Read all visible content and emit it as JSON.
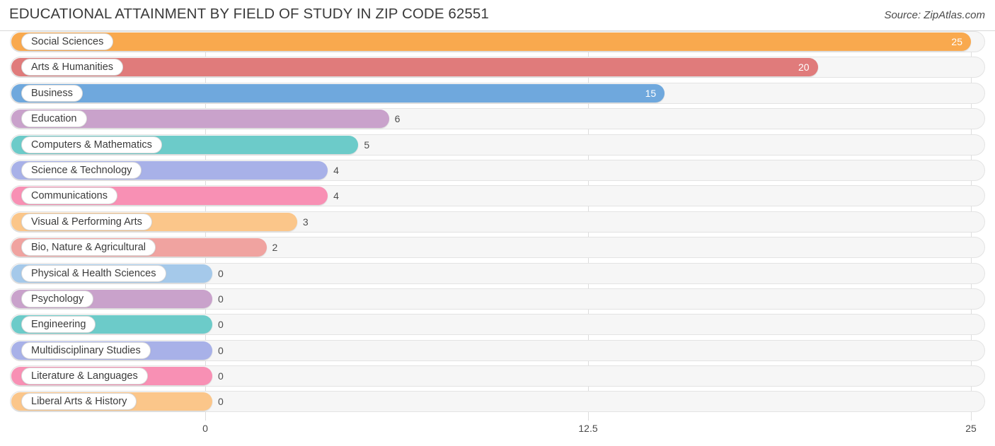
{
  "header": {
    "title": "EDUCATIONAL ATTAINMENT BY FIELD OF STUDY IN ZIP CODE 62551",
    "source": "Source: ZipAtlas.com"
  },
  "chart_data": {
    "type": "bar",
    "orientation": "horizontal",
    "title": "EDUCATIONAL ATTAINMENT BY FIELD OF STUDY IN ZIP CODE 62551",
    "xlabel": "",
    "ylabel": "",
    "xlim": [
      0,
      25
    ],
    "xticks": [
      0,
      12.5,
      25
    ],
    "xtick_labels": [
      "0",
      "12.5",
      "25"
    ],
    "grid": true,
    "legend": false,
    "categories": [
      "Social Sciences",
      "Arts & Humanities",
      "Business",
      "Education",
      "Computers & Mathematics",
      "Science & Technology",
      "Communications",
      "Visual & Performing Arts",
      "Bio, Nature & Agricultural",
      "Physical & Health Sciences",
      "Psychology",
      "Engineering",
      "Multidisciplinary Studies",
      "Literature & Languages",
      "Liberal Arts & History"
    ],
    "values": [
      25,
      20,
      15,
      6,
      5,
      4,
      4,
      3,
      2,
      0,
      0,
      0,
      0,
      0,
      0
    ],
    "value_labels": [
      "25",
      "20",
      "15",
      "6",
      "5",
      "4",
      "4",
      "3",
      "2",
      "0",
      "0",
      "0",
      "0",
      "0",
      "0"
    ],
    "colors": [
      "#f9a košt"
    ]
  },
  "bars": [
    {
      "label": "Social Sciences",
      "value": 25,
      "value_label": "25",
      "color": "#f9a köstd"
    },
    {
      "label": "Arts & Humanities",
      "value": 20,
      "value_label": "20",
      "color": "#e07b7b"
    },
    {
      "label": "Business",
      "value": 15,
      "value_label": "15",
      "color": "#6fa8dd"
    },
    {
      "label": "Education",
      "value": 6,
      "value_label": "6",
      "color": "#c9a2cb"
    },
    {
      "label": "Computers & Mathematics",
      "value": 5,
      "value_label": "5",
      "color": "#6ccbc9"
    },
    {
      "label": "Science & Technology",
      "value": 4,
      "value_label": "4",
      "color": "#a8b1e8"
    },
    {
      "label": "Communications",
      "value": 4,
      "value_label": "4",
      "color": "#f890b4"
    },
    {
      "label": "Visual & Performing Arts",
      "value": 3,
      "value_label": "3",
      "color": "#fbc68a"
    },
    {
      "label": "Bio, Nature & Agricultural",
      "value": 2,
      "value_label": "2",
      "color": "#f0a3a0"
    },
    {
      "label": "Physical & Health Sciences",
      "value": 0,
      "value_label": "0",
      "color": "#a5c9ea"
    },
    {
      "label": "Psychology",
      "value": 0,
      "value_label": "0",
      "color": "#c9a2cb"
    },
    {
      "label": "Engineering",
      "value": 0,
      "value_label": "0",
      "color": "#6ccbc9"
    },
    {
      "label": "Multidisciplinary Studies",
      "value": 0,
      "value_label": "0",
      "color": "#a8b1e8"
    },
    {
      "label": "Literature & Languages",
      "value": 0,
      "value_label": "0",
      "color": "#f890b4"
    },
    {
      "label": "Liberal Arts & History",
      "value": 0,
      "value_label": "0",
      "color": "#fbc68a"
    }
  ],
  "axis": {
    "ticks": [
      {
        "label": "0",
        "value": 0
      },
      {
        "label": "12.5",
        "value": 12.5
      },
      {
        "label": "25",
        "value": 25
      }
    ]
  }
}
